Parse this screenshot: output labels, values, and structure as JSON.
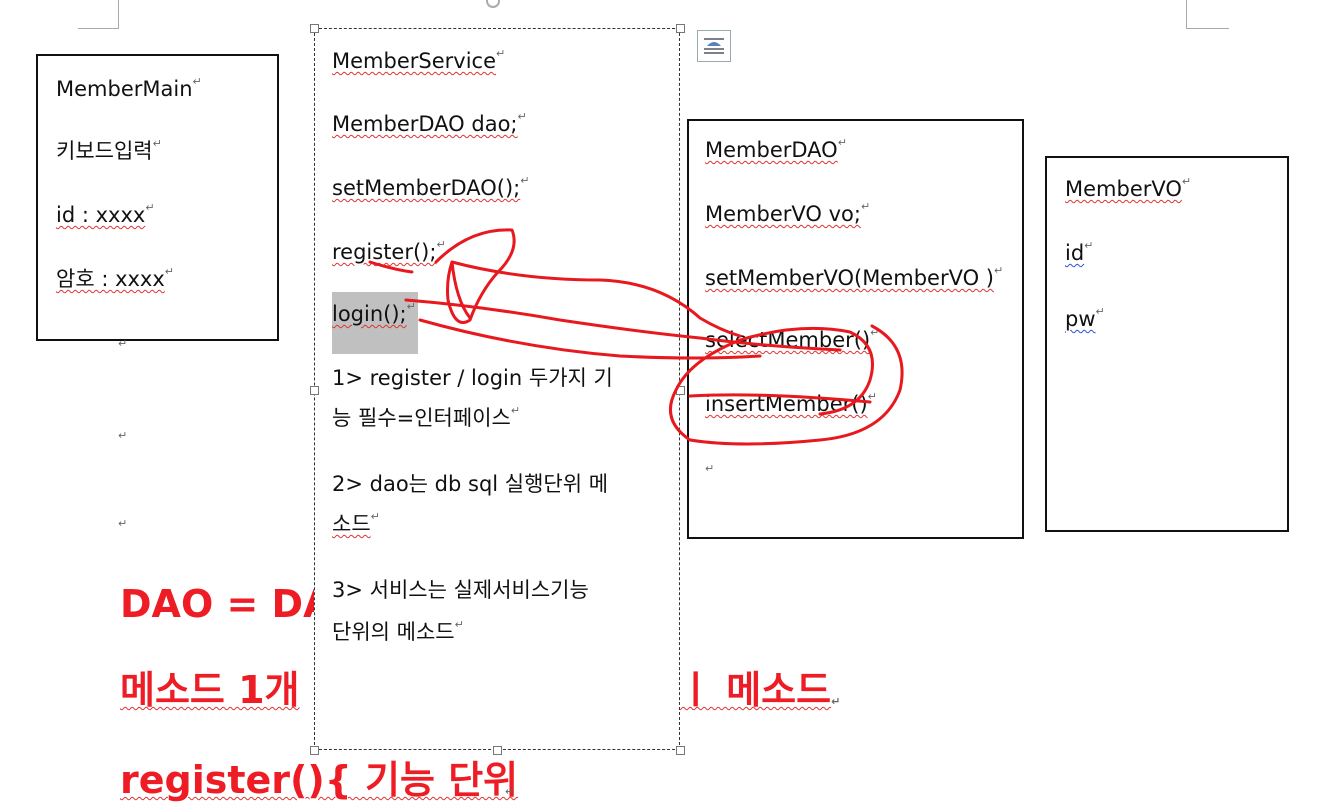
{
  "boxes": {
    "member_main": {
      "title": "MemberMain",
      "items": [
        "키보드입력",
        "id : xxxx",
        "암호 : xxxx"
      ]
    },
    "member_service": {
      "title": "MemberService",
      "items": [
        "MemberDAO dao;",
        "setMemberDAO();",
        "register();",
        "login();"
      ],
      "note1_line1": "1> register / login 두가지 기",
      "note1_line2": "능 필수=인터페이스",
      "note2_line1": "2> dao는 db sql 실행단위 메",
      "note2_line2": "소드",
      "note3_line1": "3> 서비스는 실제서비스기능",
      "note3_line2": "단위의 메소드"
    },
    "member_dao": {
      "title": "MemberDAO",
      "items": [
        "MemberVO vo;",
        "setMemberVO(MemberVO )",
        "selectMember()",
        "insertMember()"
      ]
    },
    "member_vo": {
      "title": "MemberVO",
      "items": [
        "id",
        "pw"
      ]
    }
  },
  "body_text": {
    "line1": "DAO = DAT",
    "line2_left": "메소드 1개",
    "line2_right": "ㅣ 메소드",
    "line3": "register(){ 기능 단위"
  },
  "icons": {
    "layout_options": "layout-options-icon",
    "rotate_handle": "rotate-handle-icon",
    "paragraph_mark": "↵"
  },
  "colors": {
    "accent_red": "#ee1c25",
    "spell_squiggle": "#d33",
    "grammar_squiggle": "#2a4fd6",
    "selection_highlight": "#c0c0c0"
  }
}
